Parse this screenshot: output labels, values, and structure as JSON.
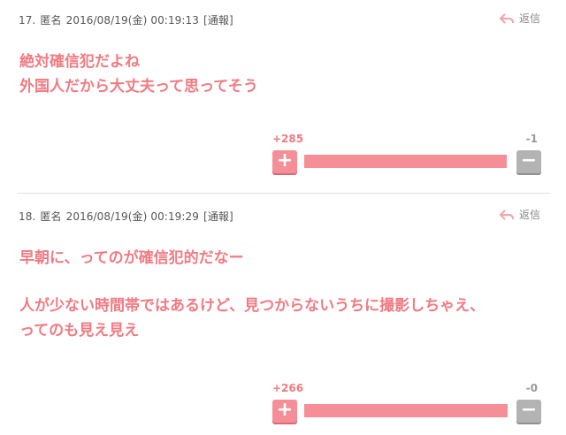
{
  "comments": [
    {
      "number": "17.",
      "author": "匿名",
      "datetime": "2016/08/19(金) 00:19:13",
      "report": "[通報]",
      "reply_label": "返信",
      "lines": [
        "絶対確信犯だよね",
        "外国人だから大丈夫って思ってそう"
      ],
      "plus": "+285",
      "minus": "-1",
      "plus_symbol": "+",
      "minus_symbol": "−",
      "plus_ratio": 0.996
    },
    {
      "number": "18.",
      "author": "匿名",
      "datetime": "2016/08/19(金) 00:19:29",
      "report": "[通報]",
      "reply_label": "返信",
      "lines": [
        "早朝に、ってのが確信犯的だなー",
        "",
        "人が少ない時間帯ではあるけど、見つからないうちに撮影しちゃえ、",
        "ってのも見え見え"
      ],
      "plus": "+266",
      "minus": "-0",
      "plus_symbol": "+",
      "minus_symbol": "−",
      "plus_ratio": 1.0
    }
  ],
  "colors": {
    "accent": "#f07b82",
    "plus_button": "#f58e96",
    "minus_button": "#b3b3b3"
  }
}
